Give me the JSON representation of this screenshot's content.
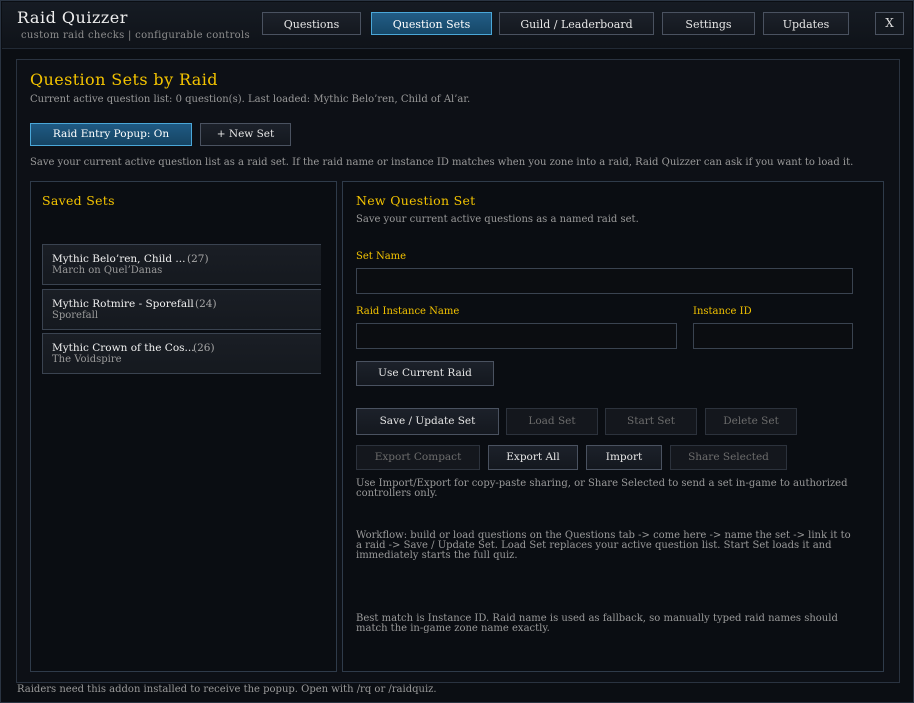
{
  "app": {
    "title": "Raid Quizzer",
    "subtitle": "custom raid checks | configurable controls",
    "close_label": "X"
  },
  "tabs": [
    {
      "label": "Questions",
      "active": false
    },
    {
      "label": "Question Sets",
      "active": true
    },
    {
      "label": "Guild / Leaderboard",
      "active": false
    },
    {
      "label": "Settings",
      "active": false
    },
    {
      "label": "Updates",
      "active": false
    }
  ],
  "page": {
    "title": "Question Sets by Raid",
    "status": "Current active question list: 0 question(s). Last loaded: Mythic Belo’ren, Child of Al’ar.",
    "popup_toggle_label": "Raid Entry Popup: On",
    "new_set_label": "+ New Set",
    "help": "Save your current active question list as a raid set. If the raid name or instance ID matches when you zone into a raid, Raid Quizzer can ask if you want to load it."
  },
  "saved_sets": {
    "title": "Saved Sets",
    "items": [
      {
        "name": "Mythic Belo’ren, Child ...",
        "count": "(27)",
        "raid": "March on Quel’Danas"
      },
      {
        "name": "Mythic Rotmire - Sporefall",
        "count": "(24)",
        "raid": "Sporefall"
      },
      {
        "name": "Mythic Crown of the Cos...",
        "count": "(26)",
        "raid": "The Voidspire"
      }
    ]
  },
  "editor": {
    "title": "New Question Set",
    "subtitle": "Save your current active questions as a named raid set.",
    "set_name_label": "Set Name",
    "set_name_value": "",
    "raid_name_label": "Raid Instance Name",
    "raid_name_value": "",
    "instance_id_label": "Instance ID",
    "instance_id_value": "",
    "use_current_label": "Use Current Raid",
    "save_label": "Save / Update Set",
    "load_label": "Load Set",
    "start_label": "Start Set",
    "delete_label": "Delete Set",
    "export_compact_label": "Export Compact",
    "export_all_label": "Export All",
    "import_label": "Import",
    "share_label": "Share Selected",
    "note_share": "Use Import/Export for copy-paste sharing, or Share Selected to send a set in-game to authorized controllers only.",
    "note_workflow": "Workflow: build or load questions on the Questions tab -> come here -> name the set -> link it to a raid -> Save / Update Set. Load Set replaces your active question list. Start Set loads it and immediately starts the full quiz.",
    "note_match": "Best match is Instance ID. Raid name is used as fallback, so manually typed raid names should match the in-game zone name exactly."
  },
  "footer": "Raiders need this addon installed to receive the popup. Open with /rq or /raidquiz.",
  "colors": {
    "accent_gold": "#f3c300",
    "accent_blue": "#4aa7d8",
    "background": "#0b0e13"
  }
}
